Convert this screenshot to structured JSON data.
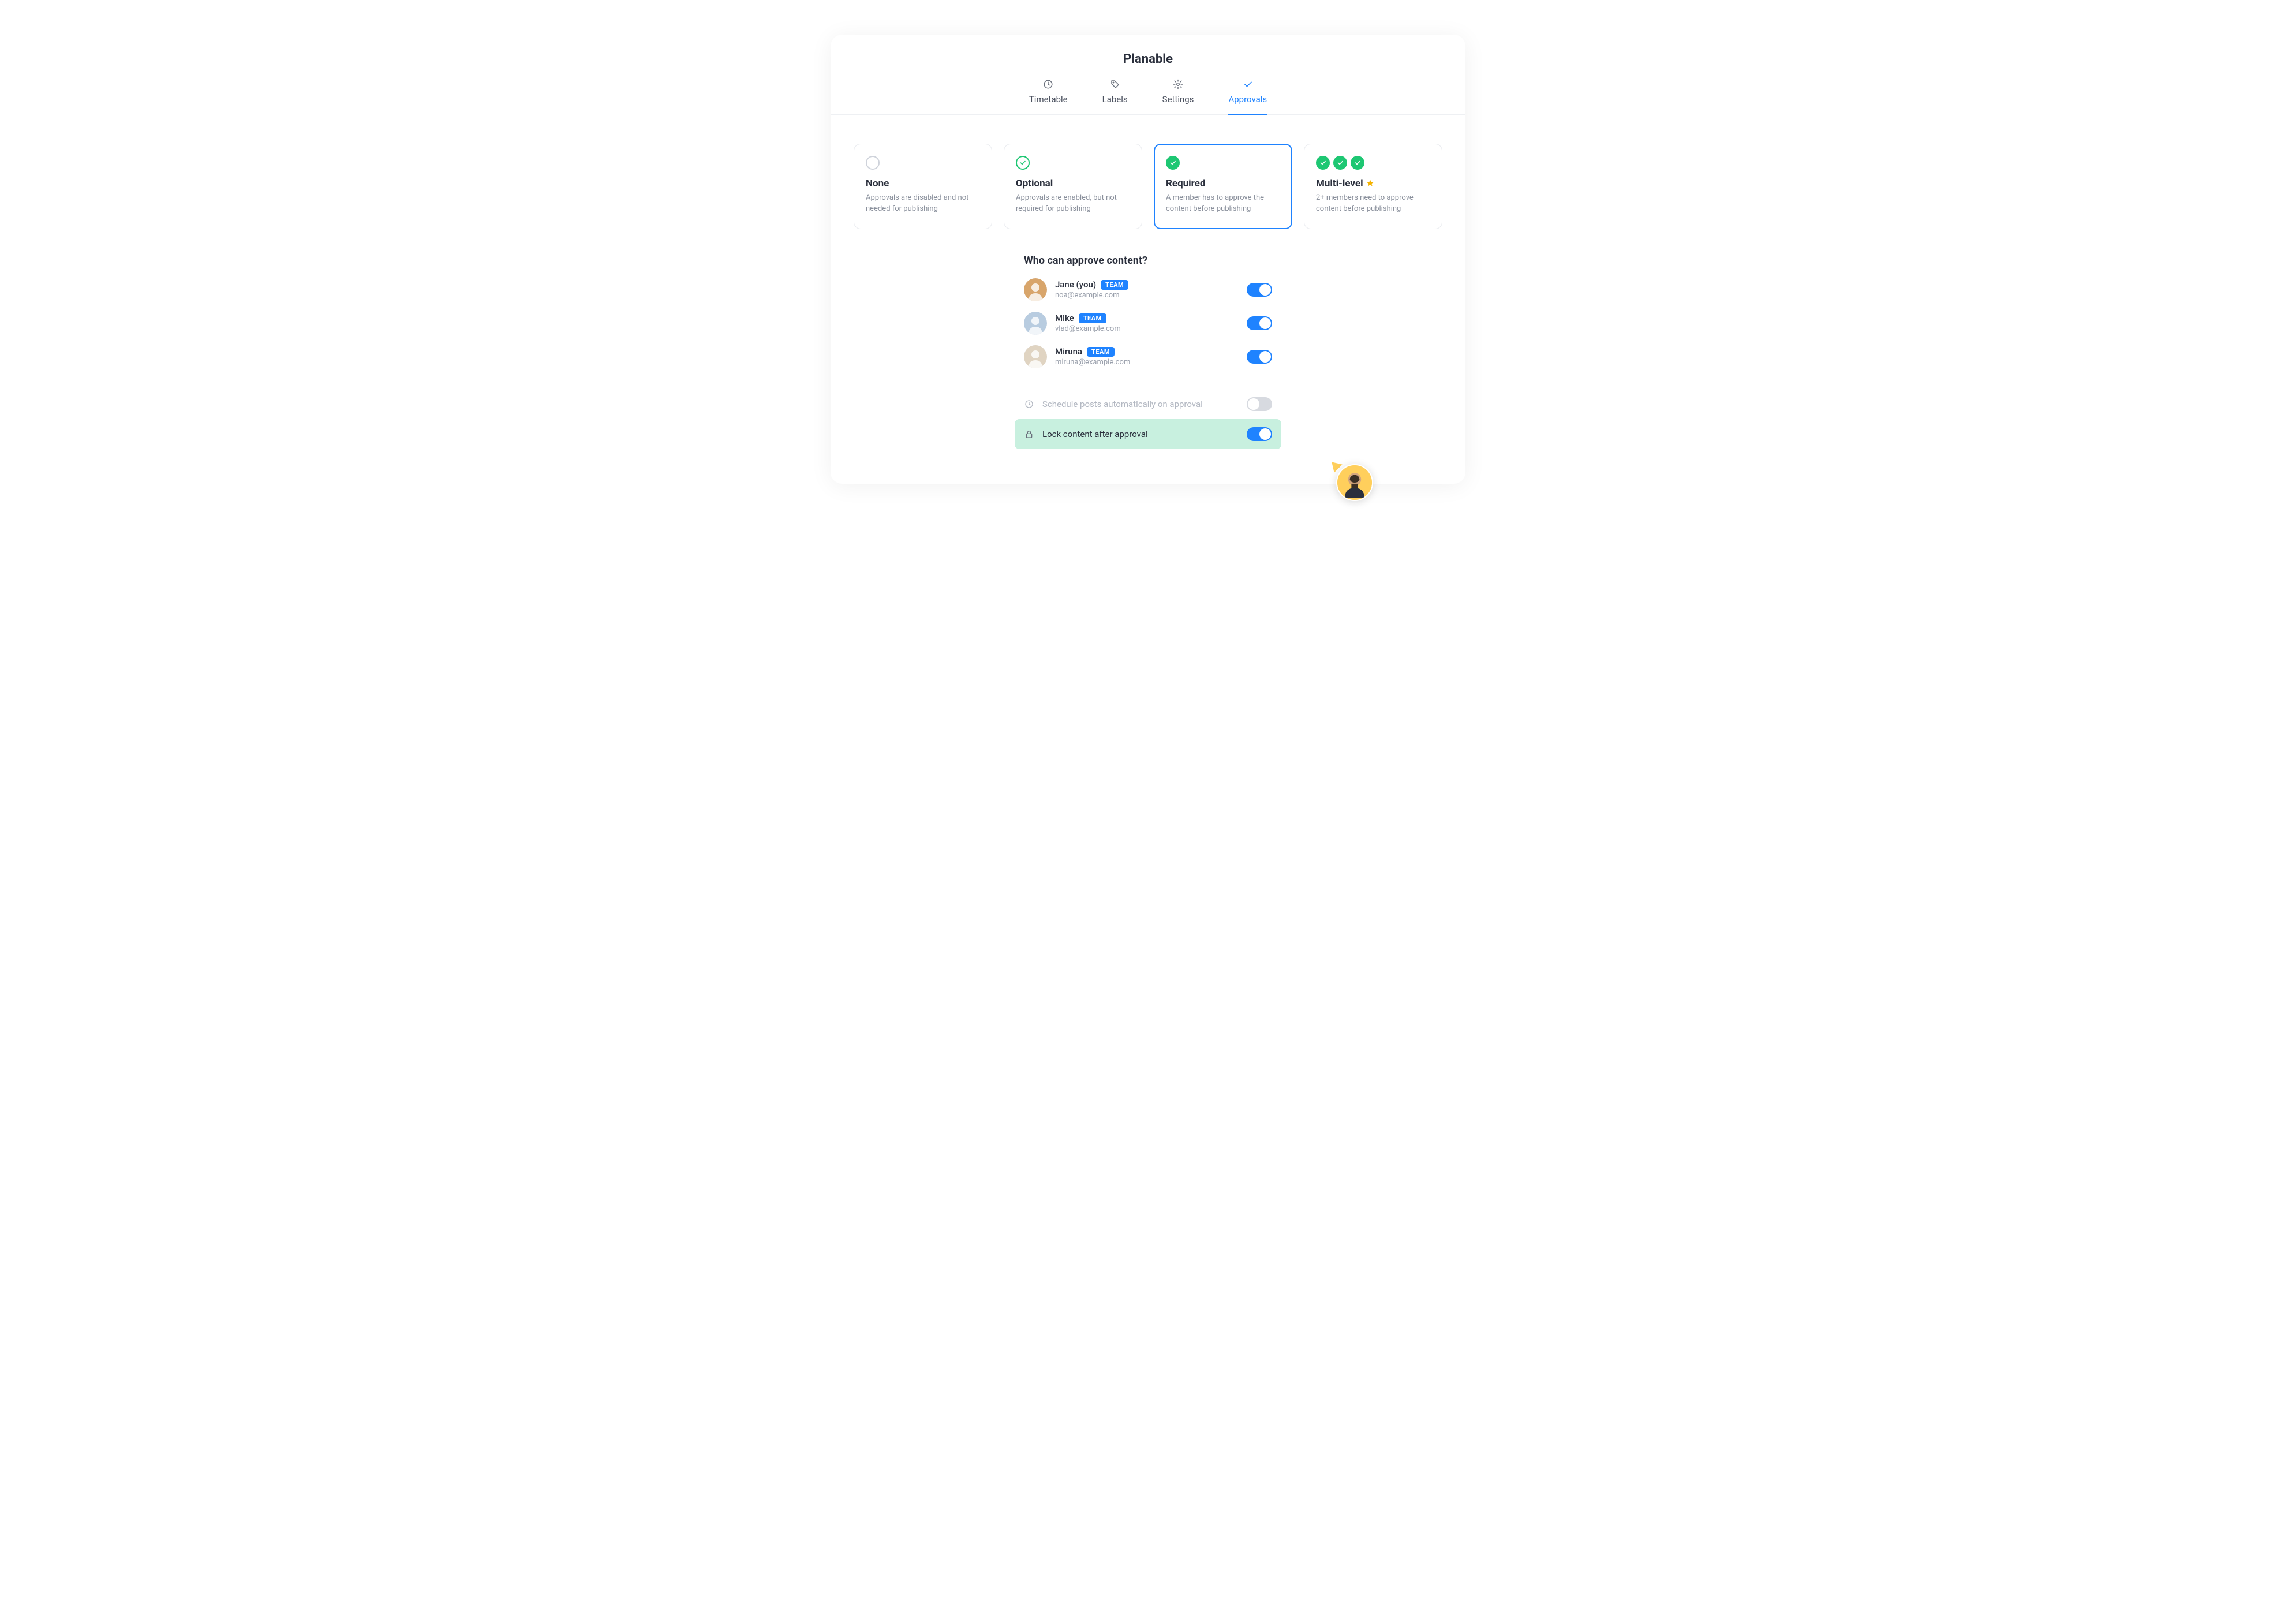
{
  "title": "Planable",
  "tabs": [
    {
      "id": "timetable",
      "label": "Timetable",
      "icon": "clock",
      "active": false
    },
    {
      "id": "labels",
      "label": "Labels",
      "icon": "tag",
      "active": false
    },
    {
      "id": "settings",
      "label": "Settings",
      "icon": "gear",
      "active": false
    },
    {
      "id": "approvals",
      "label": "Approvals",
      "icon": "check",
      "active": true
    }
  ],
  "approval_modes": [
    {
      "id": "none",
      "title": "None",
      "desc": "Approvals are disabled and not needed for publishing",
      "icon_style": "empty",
      "icon_count": 1,
      "selected": false,
      "premium": false
    },
    {
      "id": "optional",
      "title": "Optional",
      "desc": "Approvals are enabled, but not required for publishing",
      "icon_style": "green-outline",
      "icon_count": 1,
      "selected": false,
      "premium": false
    },
    {
      "id": "required",
      "title": "Required",
      "desc": "A member has to approve the content before publishing",
      "icon_style": "green-fill",
      "icon_count": 1,
      "selected": true,
      "premium": false
    },
    {
      "id": "multilevel",
      "title": "Multi-level",
      "desc": "2+ members need to approve content before publishing",
      "icon_style": "green-fill",
      "icon_count": 3,
      "selected": false,
      "premium": true
    }
  ],
  "approvers_section": {
    "heading": "Who can approve content?",
    "badge_text": "TEAM",
    "members": [
      {
        "name": "Jane (you)",
        "email": "noa@example.com",
        "enabled": true,
        "avatar_bg": "#d8a56b"
      },
      {
        "name": "Mike",
        "email": "vlad@example.com",
        "enabled": true,
        "avatar_bg": "#b8cce0"
      },
      {
        "name": "Miruna",
        "email": "miruna@example.com",
        "enabled": true,
        "avatar_bg": "#e0d4c2"
      }
    ]
  },
  "options": [
    {
      "id": "auto_schedule",
      "label": "Schedule posts automatically on approval",
      "icon": "clock",
      "enabled": false,
      "disabled_visual": true,
      "highlight": false
    },
    {
      "id": "lock_content",
      "label": "Lock content after approval",
      "icon": "lock",
      "enabled": true,
      "disabled_visual": false,
      "highlight": true
    }
  ],
  "colors": {
    "accent": "#1f83ff",
    "success": "#1ec773",
    "highlight_bg": "#c8f0df",
    "cursor_bg": "#ffcf5c"
  }
}
